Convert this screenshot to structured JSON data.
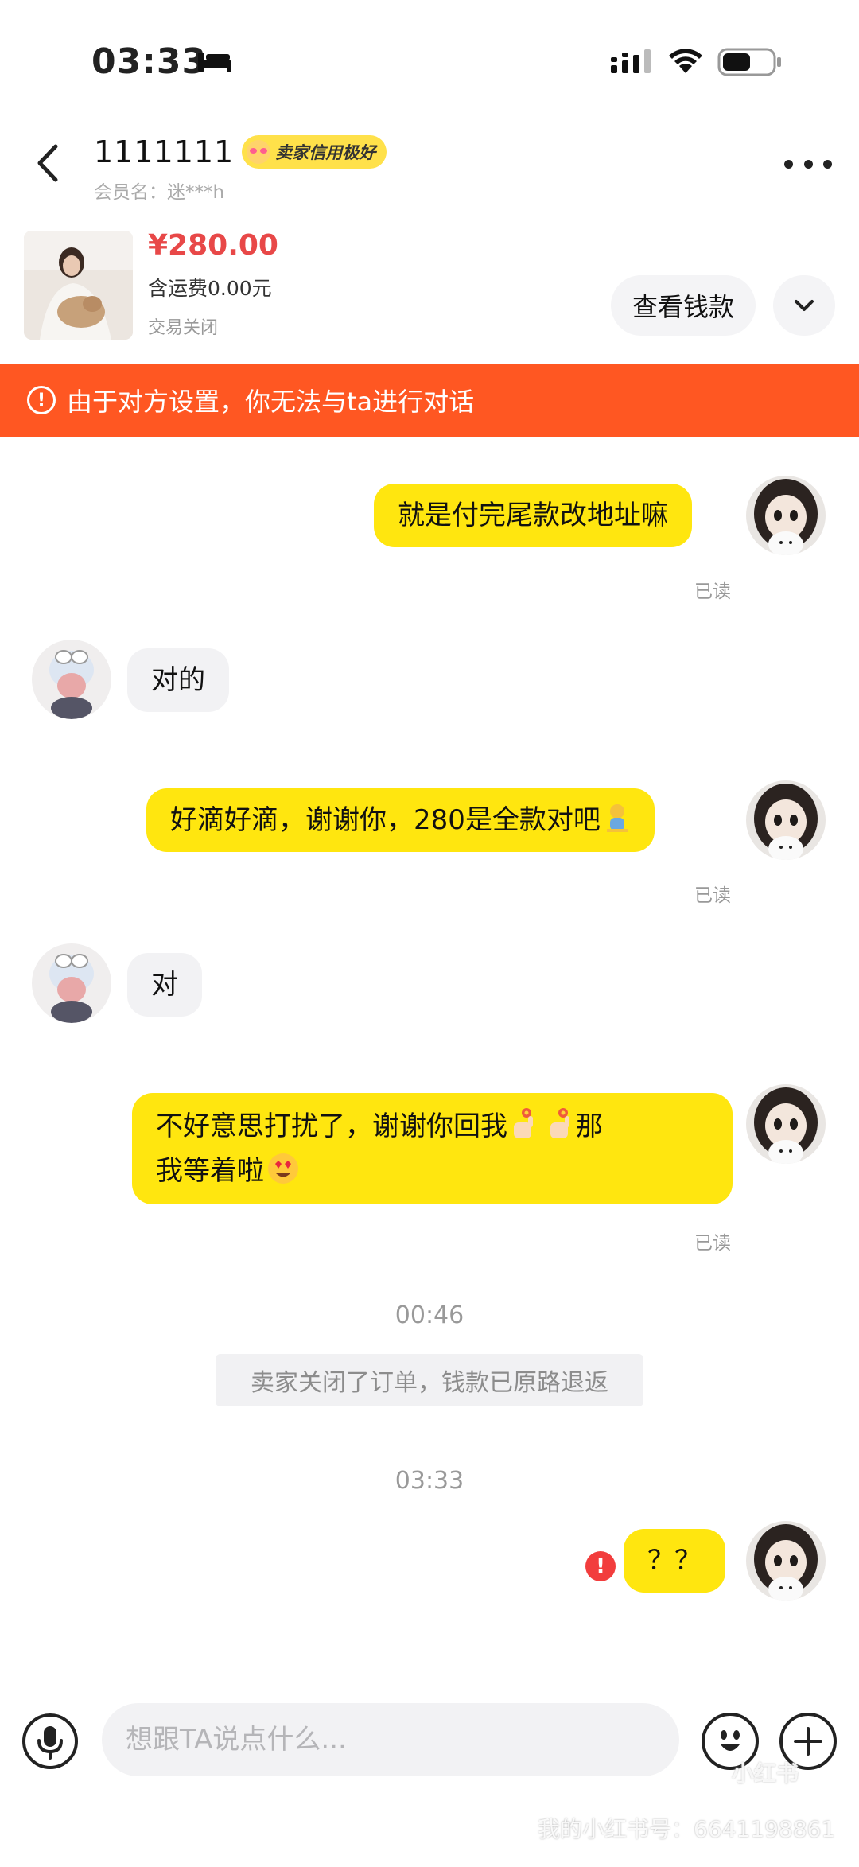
{
  "status_bar": {
    "time": "03:33"
  },
  "header": {
    "title": "1111111",
    "badge": "卖家信用极好",
    "member_name": "会员名：迷***h"
  },
  "product": {
    "price": "¥280.00",
    "shipping": "含运费0.00元",
    "status": "交易关闭",
    "view_payment": "查看钱款"
  },
  "warning": {
    "text": "由于对方设置，你无法与ta进行对话"
  },
  "messages": [
    {
      "text": "就是付完尾款改地址嘛",
      "read": "已读"
    },
    {
      "text": "对的"
    },
    {
      "text": "好滴好滴，谢谢你，280是全款对吧",
      "read": "已读"
    },
    {
      "text": "对"
    },
    {
      "line1": "不好意思打扰了，谢谢你回我",
      "line1_after": "那",
      "line2": "我等着啦",
      "read": "已读"
    },
    {
      "time": "00:46"
    },
    {
      "notice": "卖家关闭了订单，钱款已原路退返"
    },
    {
      "time": "03:33"
    },
    {
      "text": "？？",
      "error": "!"
    }
  ],
  "input": {
    "placeholder": "想跟TA说点什么..."
  },
  "watermark": {
    "logo": "小红书",
    "text": "我的小红书号：6641198861"
  },
  "colors": {
    "accent_yellow": "#ffe60f",
    "warning_orange": "#ff5722",
    "price_red": "#e84848",
    "error_red": "#f23d3d"
  }
}
